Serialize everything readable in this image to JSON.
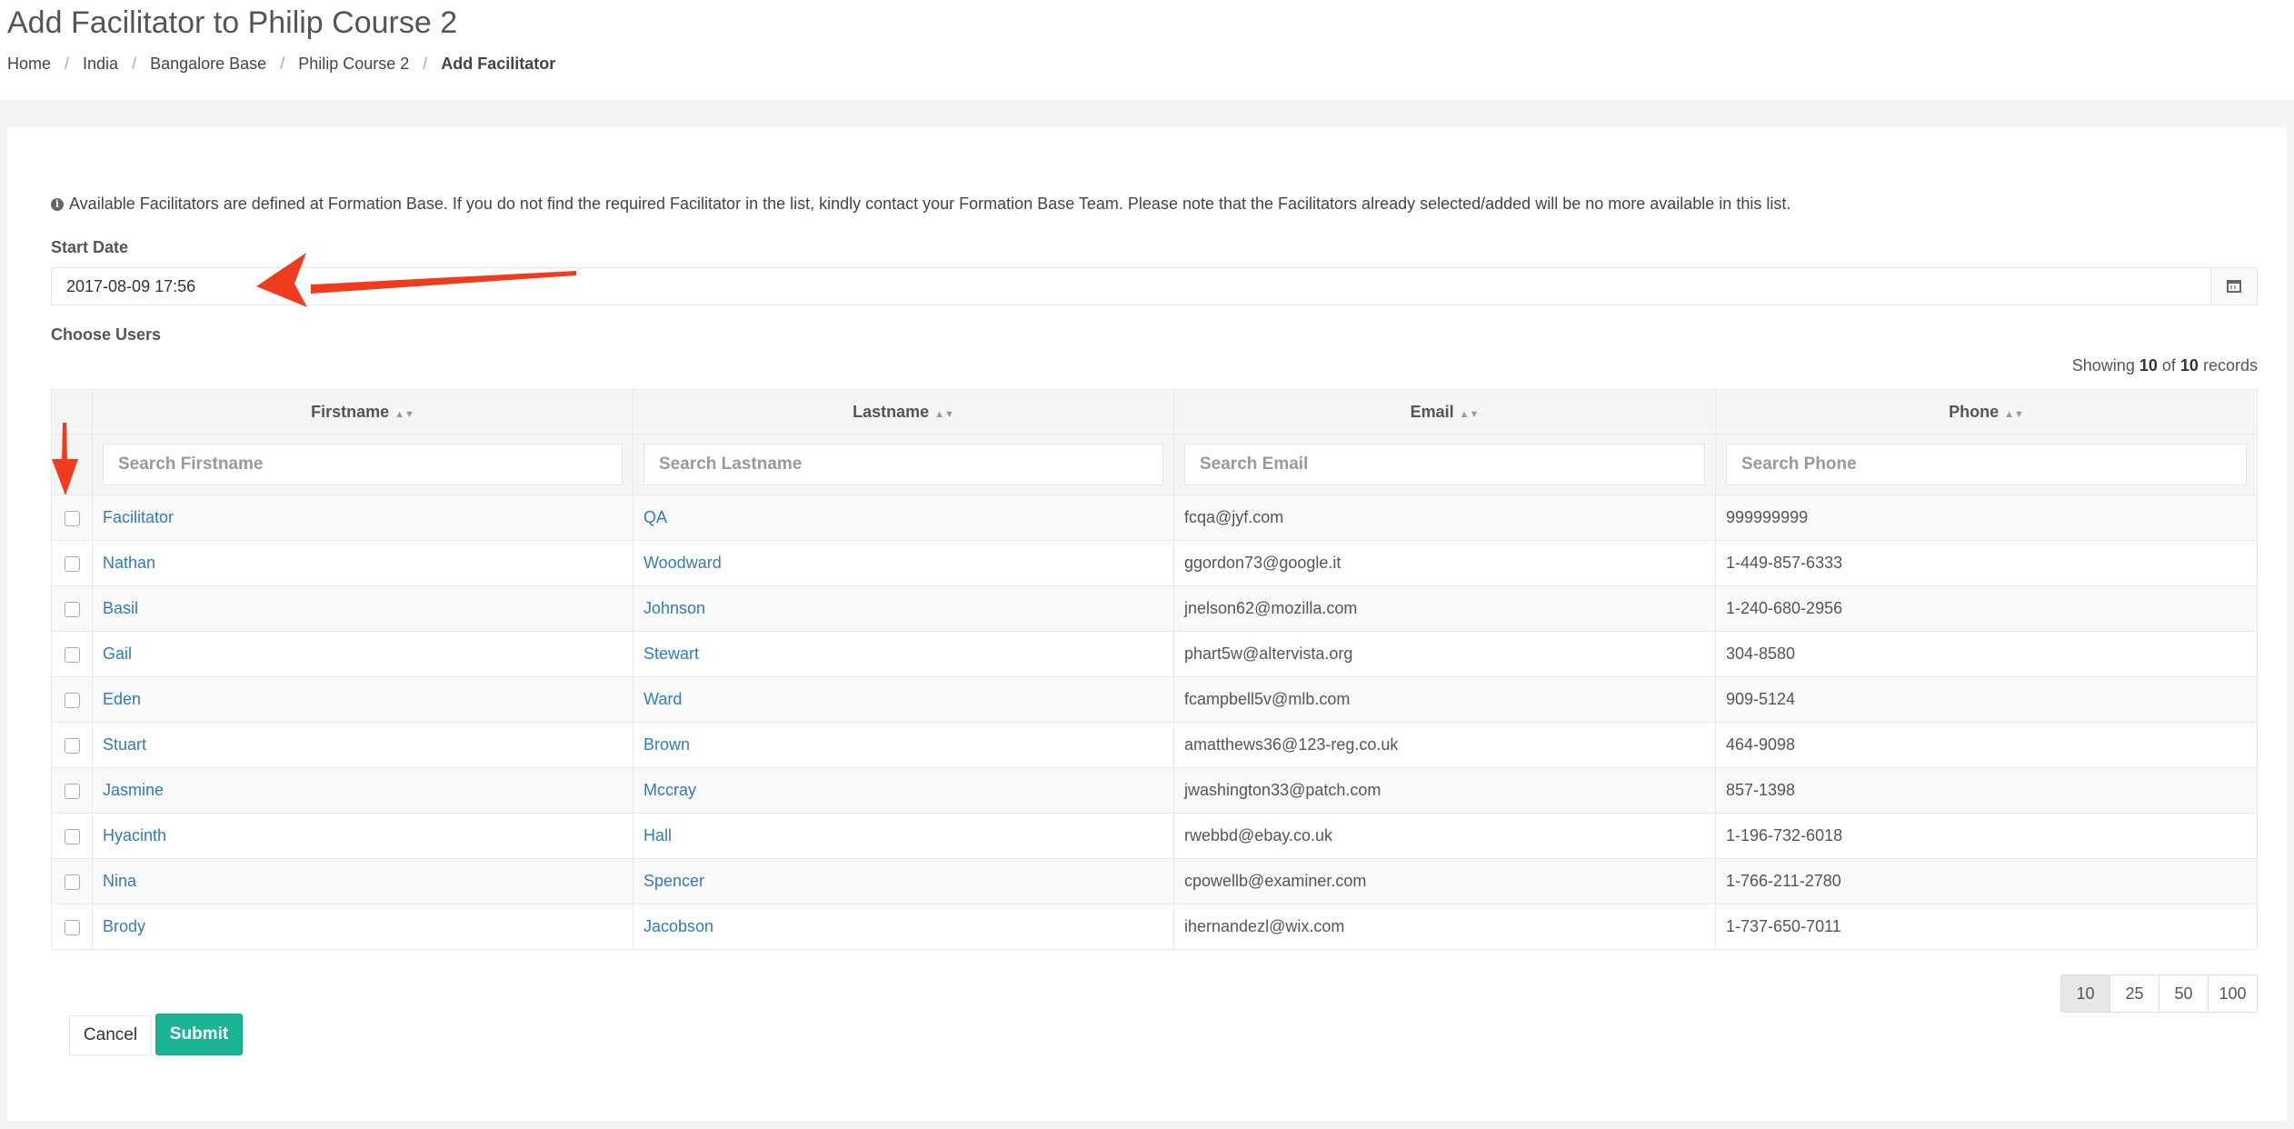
{
  "page": {
    "title": "Add Facilitator to Philip Course 2",
    "breadcrumb": [
      {
        "label": "Home"
      },
      {
        "label": "India"
      },
      {
        "label": "Bangalore Base"
      },
      {
        "label": "Philip Course 2"
      },
      {
        "label": "Add Facilitator"
      }
    ]
  },
  "form": {
    "info_text": "Available Facilitators are defined at Formation Base. If you do not find the required Facilitator in the list, kindly contact your Formation Base Team. Please note that the Facilitators already selected/added will be no more available in this list.",
    "start_date_label": "Start Date",
    "start_date_value": "2017-08-09 17:56",
    "choose_users_label": "Choose Users",
    "calendar_icon": "calendar-icon"
  },
  "table": {
    "showing": {
      "prefix": "Showing",
      "shown": "10",
      "of": "of",
      "total": "10",
      "suffix": "records"
    },
    "columns": [
      "Firstname",
      "Lastname",
      "Email",
      "Phone"
    ],
    "filters": [
      "Search Firstname",
      "Search Lastname",
      "Search Email",
      "Search Phone"
    ],
    "rows": [
      {
        "firstname": "Facilitator",
        "lastname": "QA",
        "email": "fcqa@jyf.com",
        "phone": "999999999"
      },
      {
        "firstname": "Nathan",
        "lastname": "Woodward",
        "email": "ggordon73@google.it",
        "phone": "1-449-857-6333"
      },
      {
        "firstname": "Basil",
        "lastname": "Johnson",
        "email": "jnelson62@mozilla.com",
        "phone": "1-240-680-2956"
      },
      {
        "firstname": "Gail",
        "lastname": "Stewart",
        "email": "phart5w@altervista.org",
        "phone": "304-8580"
      },
      {
        "firstname": "Eden",
        "lastname": "Ward",
        "email": "fcampbell5v@mlb.com",
        "phone": "909-5124"
      },
      {
        "firstname": "Stuart",
        "lastname": "Brown",
        "email": "amatthews36@123-reg.co.uk",
        "phone": "464-9098"
      },
      {
        "firstname": "Jasmine",
        "lastname": "Mccray",
        "email": "jwashington33@patch.com",
        "phone": "857-1398"
      },
      {
        "firstname": "Hyacinth",
        "lastname": "Hall",
        "email": "rwebbd@ebay.co.uk",
        "phone": "1-196-732-6018"
      },
      {
        "firstname": "Nina",
        "lastname": "Spencer",
        "email": "cpowellb@examiner.com",
        "phone": "1-766-211-2780"
      },
      {
        "firstname": "Brody",
        "lastname": "Jacobson",
        "email": "ihernandezl@wix.com",
        "phone": "1-737-650-7011"
      }
    ],
    "page_sizes": [
      "10",
      "25",
      "50",
      "100"
    ],
    "selected_page_size": "10"
  },
  "actions": {
    "cancel_label": "Cancel",
    "submit_label": "Submit"
  },
  "annotations": {
    "arrow_color": "#f03c1e"
  }
}
